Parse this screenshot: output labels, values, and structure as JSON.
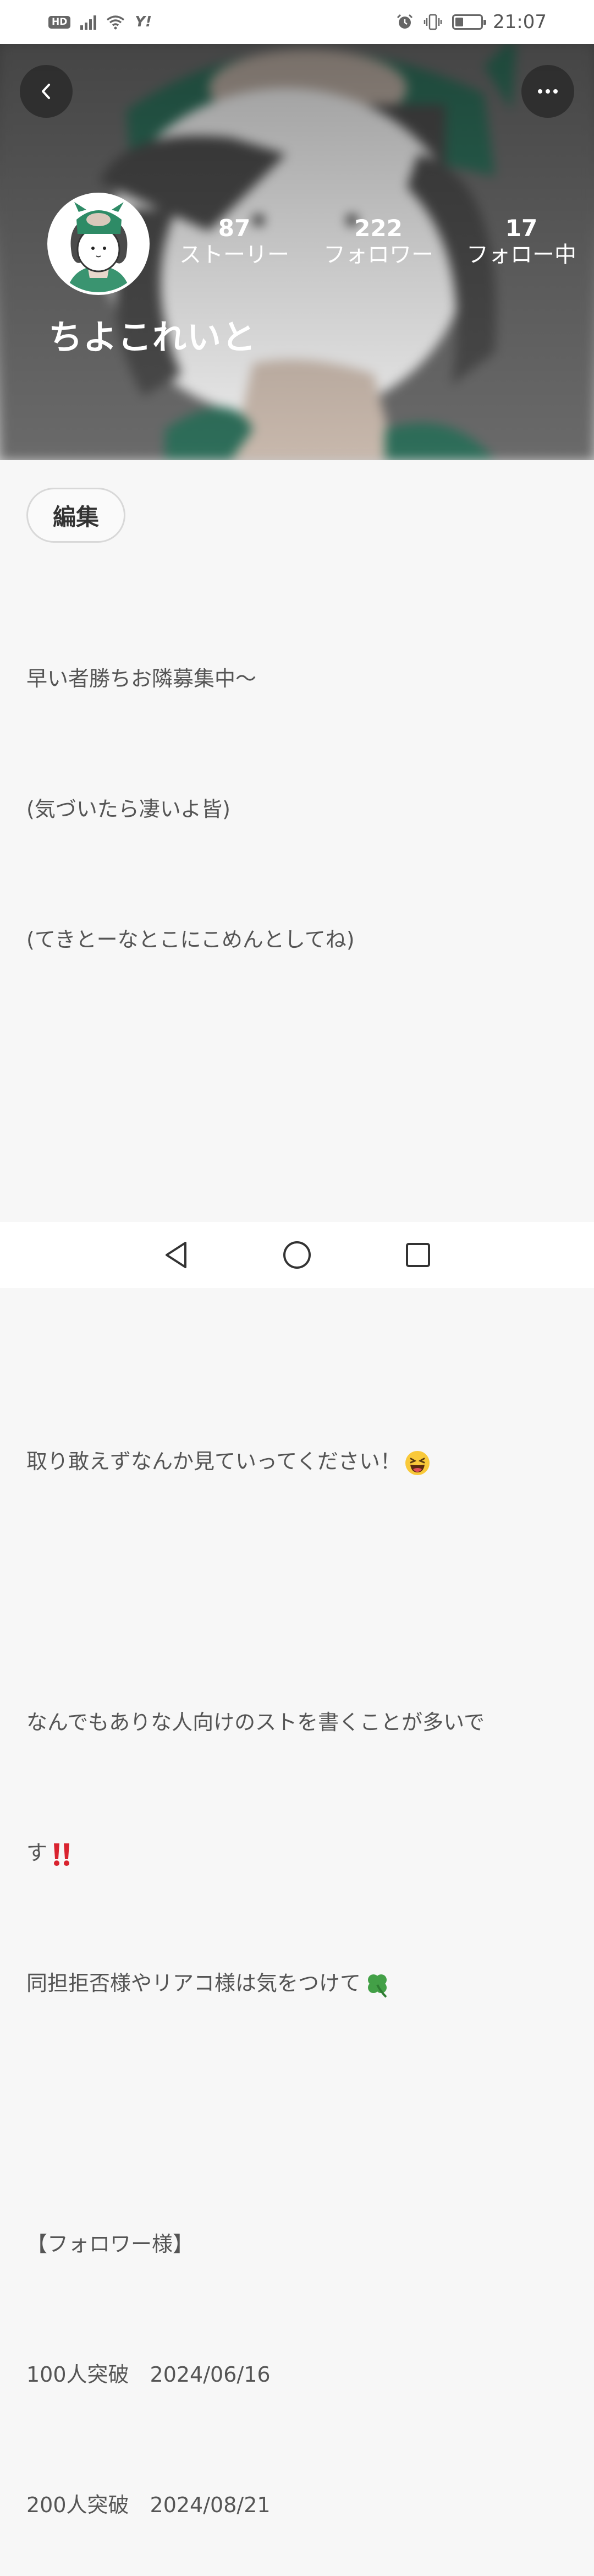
{
  "status_bar": {
    "hd": "HD",
    "carrier_icon": "Y!",
    "time": "21:07",
    "icons": [
      "hd-icon",
      "signal-icon",
      "wifi-icon",
      "yahoo-icon",
      "alarm-icon",
      "vibrate-icon",
      "battery-icon"
    ]
  },
  "profile": {
    "username": "ちよこれいと",
    "stats": {
      "stories": {
        "count": "87",
        "label": "ストーリー"
      },
      "followers": {
        "count": "222",
        "label": "フォロワー"
      },
      "following": {
        "count": "17",
        "label": "フォロー中"
      }
    },
    "edit_label": "編集"
  },
  "bio": {
    "line1": "早い者勝ちお隣募集中〜",
    "line2": "(気づいたら凄いよ皆)",
    "line3": "(てきとーなとこにこめんとしてね)",
    "line4": "取り敢えずなんか見ていってください！",
    "line4_emoji": "laughing-face-icon",
    "line5": "なんでもありな人向けのストを書くことが多いで",
    "line6": "す",
    "line6_emoji": "double-exclamation-icon",
    "line7": "同担拒否様やリアコ様は気をつけて",
    "line7_emoji": "four-leaf-clover-icon",
    "line8": "【フォロワー様】",
    "line9": "100人突破　2024/06/16",
    "line10": "200人突破　2024/08/21"
  },
  "colors": {
    "accent_green": "#2e8b66",
    "background": "#f7f7f7",
    "text": "#555555"
  }
}
